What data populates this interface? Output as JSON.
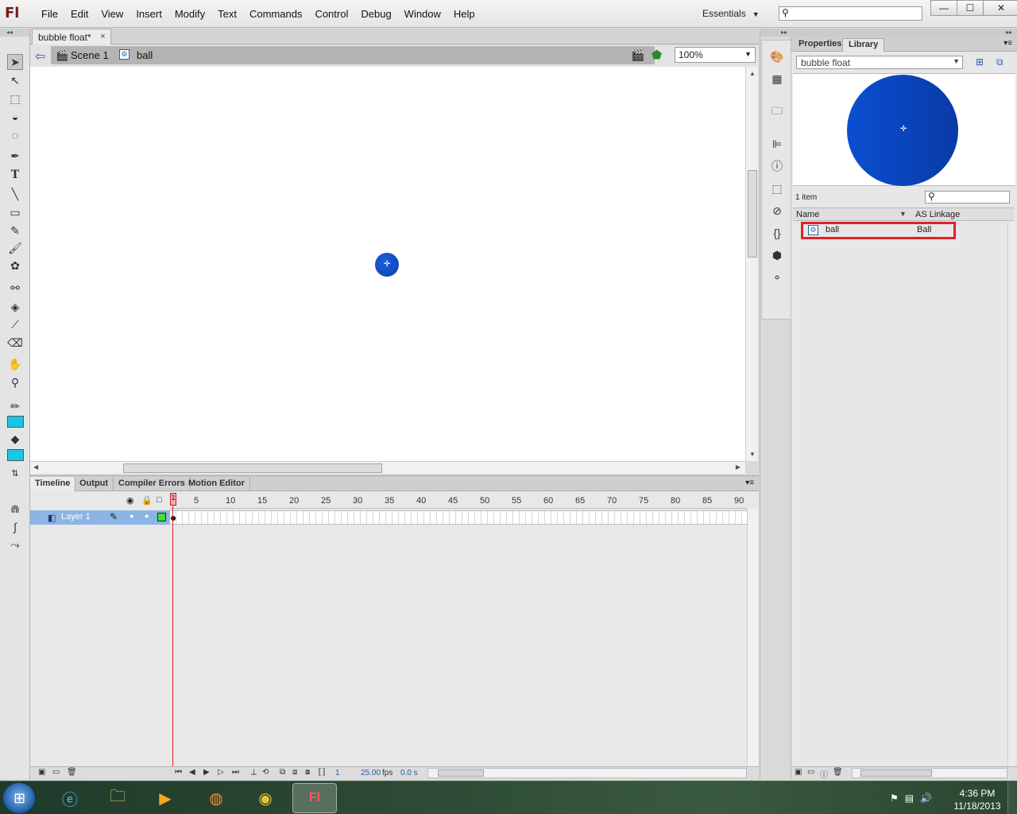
{
  "app": {
    "logo": "Fl",
    "menus": [
      "File",
      "Edit",
      "View",
      "Insert",
      "Modify",
      "Text",
      "Commands",
      "Control",
      "Debug",
      "Window",
      "Help"
    ],
    "workspace": "Essentials",
    "search_icon": "magnifier-icon",
    "window_controls": {
      "minimize": "—",
      "maximize": "☐",
      "close": "✕"
    }
  },
  "document": {
    "tab_title": "bubble float*",
    "close": "×",
    "scene": "Scene 1",
    "symbol": "ball",
    "zoom": "100%"
  },
  "timeline": {
    "tabs": [
      "Timeline",
      "Output",
      "Compiler Errors",
      "Motion Editor"
    ],
    "active_tab": "Timeline",
    "layer_name": "Layer 1",
    "ruler": [
      "5",
      "10",
      "15",
      "20",
      "25",
      "30",
      "35",
      "40",
      "45",
      "50",
      "55",
      "60",
      "65",
      "70",
      "75",
      "80",
      "85",
      "90"
    ],
    "current_frame_marker": "1",
    "status": {
      "frame": "1",
      "fps": "25.00",
      "fps_label": "fps",
      "time": "0.0 s"
    }
  },
  "library": {
    "tabs": [
      "Properties",
      "Library"
    ],
    "active_tab": "Library",
    "document": "bubble float",
    "item_count": "1 item",
    "columns": {
      "name": "Name",
      "linkage": "AS Linkage"
    },
    "items": [
      {
        "name": "ball",
        "linkage": "Ball"
      }
    ],
    "preview_color": "#0a4fd0"
  },
  "colors": {
    "stroke": "#19c6e6",
    "fill": "#19c6e6",
    "ball": "#0b44c0",
    "highlight": "#e0202a"
  },
  "taskbar": {
    "time": "4:36 PM",
    "date": "11/18/2013"
  }
}
